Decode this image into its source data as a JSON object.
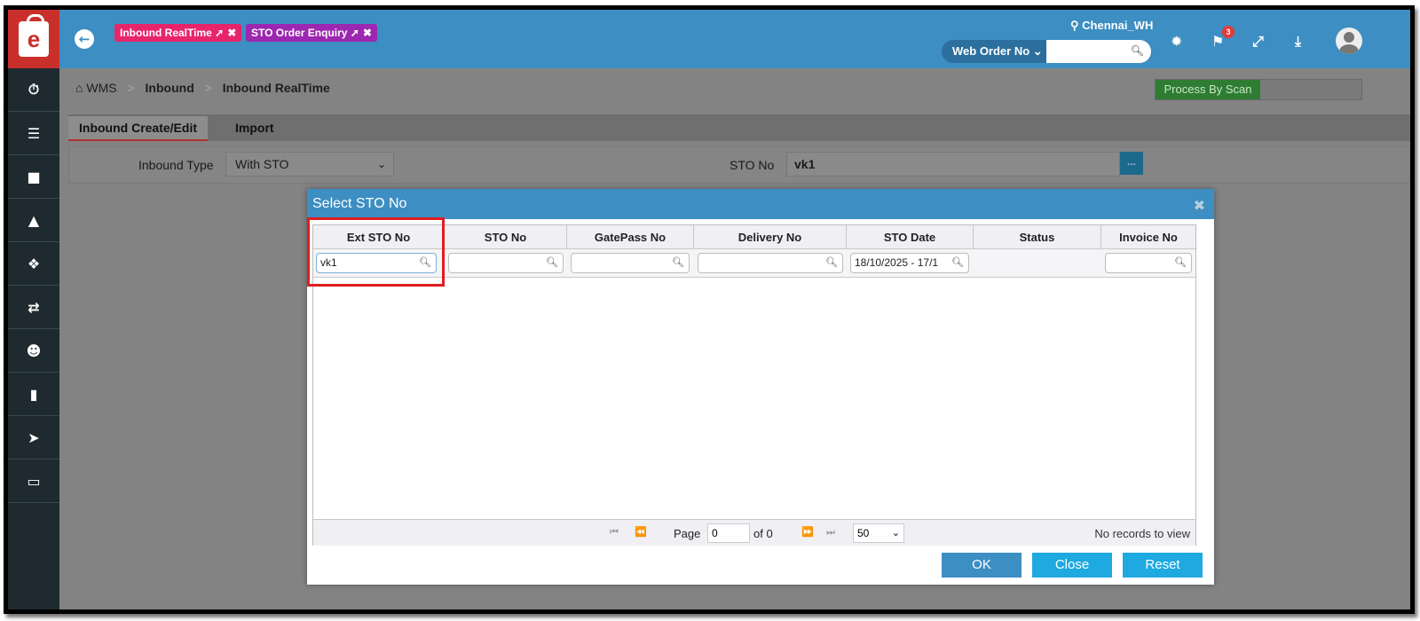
{
  "topbar": {
    "logo": "e",
    "pinned_tabs": [
      {
        "label": "Inbound RealTime",
        "color": "#e8246b"
      },
      {
        "label": "STO Order Enquiry",
        "color": "#9c27b0"
      }
    ],
    "location": "Chennai_WH",
    "search_select": "Web Order No",
    "search_value": "",
    "flag_badge": "3",
    "icons": [
      "back-arrow-icon",
      "gear-icon",
      "flag-icon",
      "expand-icon",
      "download-icon",
      "user-avatar-icon"
    ]
  },
  "sidebar": {
    "items": [
      "dashboard-icon",
      "inbound-icon",
      "cart-icon",
      "shopping-bag-icon",
      "cubes-icon",
      "transfer-icon",
      "add-user-icon",
      "book-icon",
      "tag-icon",
      "card-icon"
    ]
  },
  "breadcrumb": {
    "home": "WMS",
    "items": [
      "Inbound",
      "Inbound RealTime"
    ]
  },
  "process_by_scan": "Process By Scan",
  "tabs": [
    "Inbound Create/Edit",
    "Import"
  ],
  "form": {
    "inbound_type_label": "Inbound Type",
    "inbound_type_value": "With STO",
    "sto_no_label": "STO No",
    "sto_no_value": "vk1",
    "lookup_button": "..."
  },
  "modal": {
    "title": "Select STO No",
    "columns": [
      "Ext STO No",
      "STO No",
      "GatePass No",
      "Delivery No",
      "STO Date",
      "Status",
      "Invoice No"
    ],
    "filters": {
      "ext_sto_no": "vk1",
      "sto_no": "",
      "gatepass_no": "",
      "delivery_no": "",
      "sto_date": "18/10/2025 - 17/1",
      "invoice_no": ""
    },
    "rows": [],
    "pager": {
      "page_label": "Page",
      "page_value": "0",
      "of_label": "of 0",
      "rows_per_page": "50",
      "records": "No records to view"
    },
    "buttons": {
      "ok": "OK",
      "close": "Close",
      "reset": "Reset"
    }
  },
  "colors": {
    "topbar": "#3d8ec2",
    "logo": "#c9302c",
    "sidebar": "#1f2a30",
    "highlight": "#e01e1e",
    "scan_button": "#2e7d32",
    "ok_button": "#3d8ec2",
    "secondary_button": "#1ea9e1"
  }
}
